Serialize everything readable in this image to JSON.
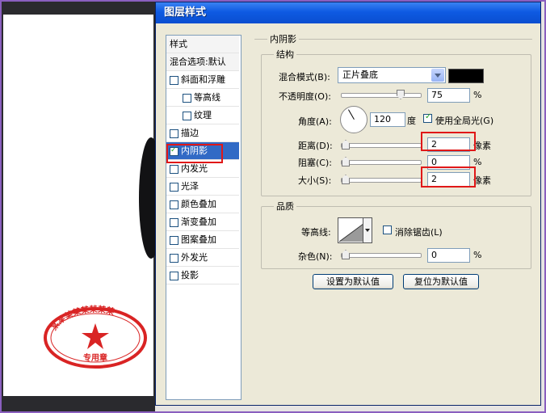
{
  "dialog": {
    "title": "图层样式"
  },
  "style_list": {
    "header_styles": "样式",
    "header_blend": "混合选项:默认",
    "items": [
      {
        "label": "斜面和浮雕",
        "checked": false,
        "indent": false
      },
      {
        "label": "等高线",
        "checked": false,
        "indent": true
      },
      {
        "label": "纹理",
        "checked": false,
        "indent": true
      },
      {
        "label": "描边",
        "checked": false,
        "indent": false
      },
      {
        "label": "内阴影",
        "checked": true,
        "indent": false,
        "selected": true
      },
      {
        "label": "内发光",
        "checked": false,
        "indent": false
      },
      {
        "label": "光泽",
        "checked": false,
        "indent": false
      },
      {
        "label": "颜色叠加",
        "checked": false,
        "indent": false
      },
      {
        "label": "渐变叠加",
        "checked": false,
        "indent": false
      },
      {
        "label": "图案叠加",
        "checked": false,
        "indent": false
      },
      {
        "label": "外发光",
        "checked": false,
        "indent": false
      },
      {
        "label": "投影",
        "checked": false,
        "indent": false
      }
    ]
  },
  "inner_shadow": {
    "section_title": "内阴影",
    "structure": {
      "title": "结构",
      "blend_mode_label": "混合模式(B):",
      "blend_mode_value": "正片叠底",
      "shadow_color": "#000000",
      "opacity_label": "不透明度(O):",
      "opacity_value": "75",
      "opacity_unit": "%",
      "angle_label": "角度(A):",
      "angle_value": "120",
      "angle_unit": "度",
      "use_global_light_label": "使用全局光(G)",
      "use_global_light_checked": true,
      "distance_label": "距离(D):",
      "distance_value": "2",
      "distance_unit": "像素",
      "choke_label": "阻塞(C):",
      "choke_value": "0",
      "choke_unit": "%",
      "size_label": "大小(S):",
      "size_value": "2",
      "size_unit": "像素"
    },
    "quality": {
      "title": "品质",
      "contour_label": "等高线:",
      "anti_alias_label": "消除锯齿(L)",
      "anti_alias_checked": false,
      "noise_label": "杂色(N):",
      "noise_value": "0",
      "noise_unit": "%"
    },
    "buttons": {
      "make_default": "设置为默认值",
      "reset_default": "复位为默认值"
    }
  },
  "seal": {
    "top_text": "某某某某某某某某",
    "bottom_text": "专用章",
    "color": "#d92424"
  }
}
